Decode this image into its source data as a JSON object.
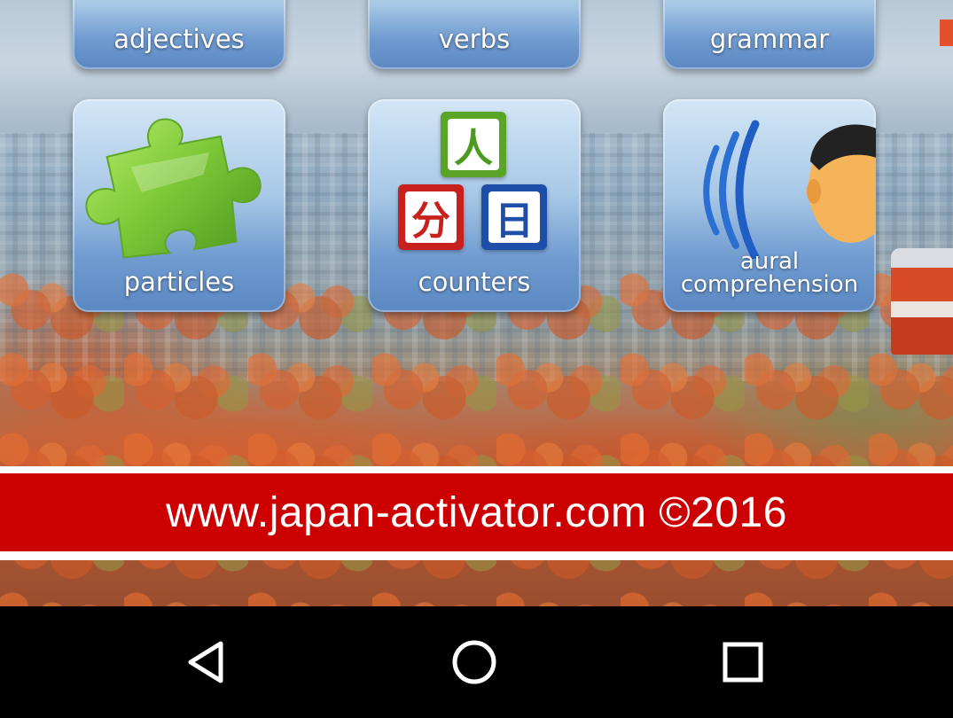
{
  "tiles_top": [
    {
      "label": "adjectives"
    },
    {
      "label": "verbs"
    },
    {
      "label": "grammar"
    }
  ],
  "tiles_bottom": [
    {
      "label": "particles",
      "icon": "puzzle-piece-icon"
    },
    {
      "label": "counters",
      "icon": "kanji-blocks-icon",
      "kanji": [
        "人",
        "分",
        "日"
      ],
      "kanji_colors": [
        "#4e9a1e",
        "#c8201c",
        "#1e4fa8"
      ]
    },
    {
      "label_line1": "aural",
      "label_line2": "comprehension",
      "icon": "listening-face-icon"
    }
  ],
  "banner": {
    "text": "www.japan-activator.com ©2016",
    "color": "#cc0000"
  },
  "navbar": {
    "back": "back-icon",
    "home": "home-icon",
    "recents": "recents-icon"
  }
}
